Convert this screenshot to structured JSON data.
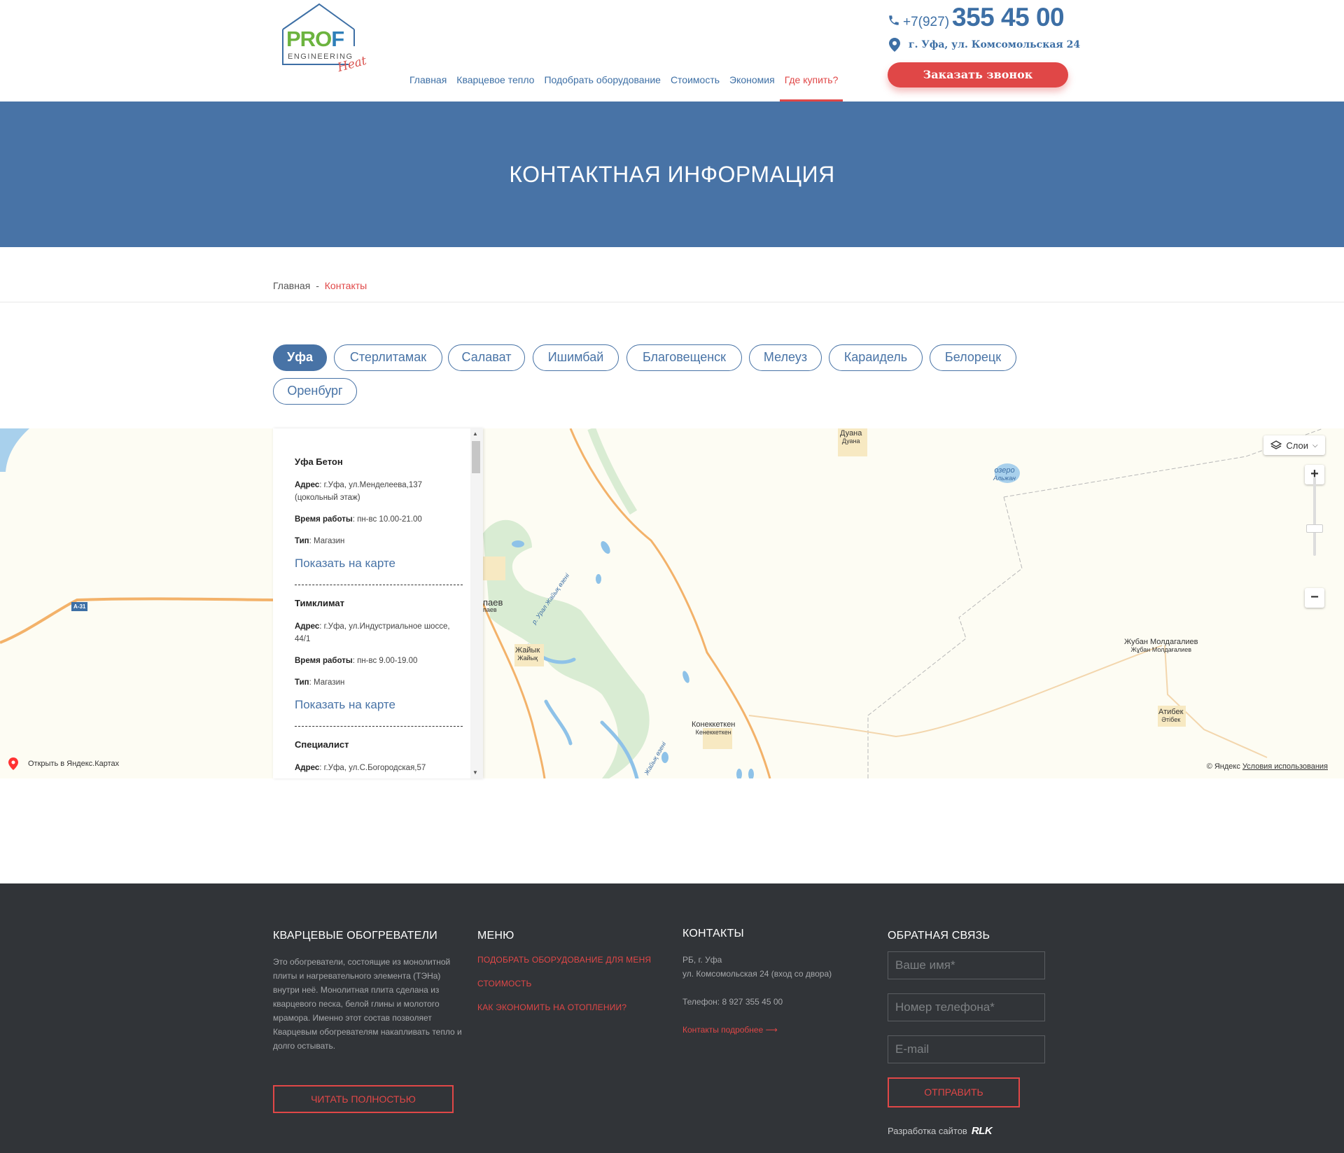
{
  "header": {
    "logo": {
      "text_prof_1": "PRO",
      "text_prof_2": "F",
      "text_engineering": "ENGINEERING",
      "text_heat": "Heat"
    },
    "nav": [
      {
        "label": "Главная"
      },
      {
        "label": "Кварцевое тепло"
      },
      {
        "label": "Подобрать оборудование"
      },
      {
        "label": "Стоимость"
      },
      {
        "label": "Экономия"
      },
      {
        "label": "Где купить?",
        "active": true
      }
    ],
    "phone_prefix": "+7(927)",
    "phone_number": "355 45 00",
    "address": "г. Уфа, ул. Комсомольская 24",
    "call_button": "Заказать звонок"
  },
  "banner": {
    "title": "КОНТАКТНАЯ ИНФОРМАЦИЯ"
  },
  "breadcrumb": {
    "home": "Главная",
    "separator": "-",
    "current": "Контакты"
  },
  "cities": [
    {
      "label": "Уфа",
      "active": true
    },
    {
      "label": "Стерлитамак"
    },
    {
      "label": "Салават"
    },
    {
      "label": "Ишимбай"
    },
    {
      "label": "Благовещенск"
    },
    {
      "label": "Мелеуз"
    },
    {
      "label": "Караидель"
    },
    {
      "label": "Белорецк"
    },
    {
      "label": "Оренбург"
    }
  ],
  "shops": [
    {
      "name": "Уфа Бетон",
      "address_label": "Адрес",
      "address": "г.Уфа, ул.Менделеева,137 (цокольный этаж)",
      "hours_label": "Время работы",
      "hours": "пн-вс 10.00-21.00",
      "type_label": "Тип",
      "type": "Магазин",
      "show_map": "Показать на карте"
    },
    {
      "name": "Тимклимат",
      "address_label": "Адрес",
      "address": "г.Уфа, ул.Индустриальное шоссе, 44/1",
      "hours_label": "Время работы",
      "hours": "пн-вс 9.00-19.00",
      "type_label": "Тип",
      "type": "Магазин",
      "show_map": "Показать на карте"
    },
    {
      "name": "Специалист",
      "address_label": "Адрес",
      "address": "г.Уфа, ул.С.Богородская,57"
    }
  ],
  "map": {
    "labels": {
      "duana": "Дуана",
      "duana_sub": "Дуана",
      "ozero": "озеро",
      "ozero_sub": "Альжан",
      "zhuban": "Жубан Молдагалиев",
      "zhuban_sub": "Жұбан Молдағалиев",
      "atibek": "Атибек",
      "atibek_sub": "Әтібек",
      "konek": "Конеккеткен",
      "konek_sub": "Кенеккеткен",
      "zhaiyk": "Жайык",
      "zhaiyk_sub": "Жайық",
      "kapaev": "паев",
      "kapaev_sub": "паев",
      "road": "А-31",
      "river": "р. Урал Жайық өзені",
      "river2": "Жайық өзені"
    },
    "open_link": "Открыть в Яндекс.Картах",
    "layers": "Слои",
    "copyright": "© Яндекс",
    "terms": "Условия использования"
  },
  "footer": {
    "about": {
      "title": "КВАРЦЕВЫЕ ОБОГРЕВАТЕЛИ",
      "text": "Это обогреватели, состоящие из монолитной плиты и нагревательного элемента (ТЭНа) внутри неё. Монолитная плита сделана из кварцевого песка, белой глины и молотого мрамора. Именно этот состав позволяет Кварцевым обогревателям накапливать тепло и долго остывать.",
      "button": "ЧИТАТЬ ПОЛНОСТЬЮ"
    },
    "menu": {
      "title": "МЕНЮ",
      "links": [
        "ПОДОБРАТЬ ОБОРУДОВАНИЕ ДЛЯ МЕНЯ",
        "СТОИМОСТЬ",
        "КАК ЭКОНОМИТЬ НА ОТОПЛЕНИИ?"
      ]
    },
    "contacts": {
      "title": "КОНТАКТЫ",
      "line1": "РБ, г. Уфа",
      "line2": "ул. Комсомольская 24 (вход со двора)",
      "phone": "Телефон: 8 927 355 45 00",
      "more": "Контакты подробнее ⟶"
    },
    "feedback": {
      "title": "ОБРАТНАЯ СВЯЗЬ",
      "name_placeholder": "Ваше имя*",
      "phone_placeholder": "Номер телефона*",
      "email_placeholder": "E-mail",
      "send": "ОТПРАВИТЬ",
      "dev_text": "Разработка сайтов",
      "dev_logo": "RLK"
    }
  }
}
